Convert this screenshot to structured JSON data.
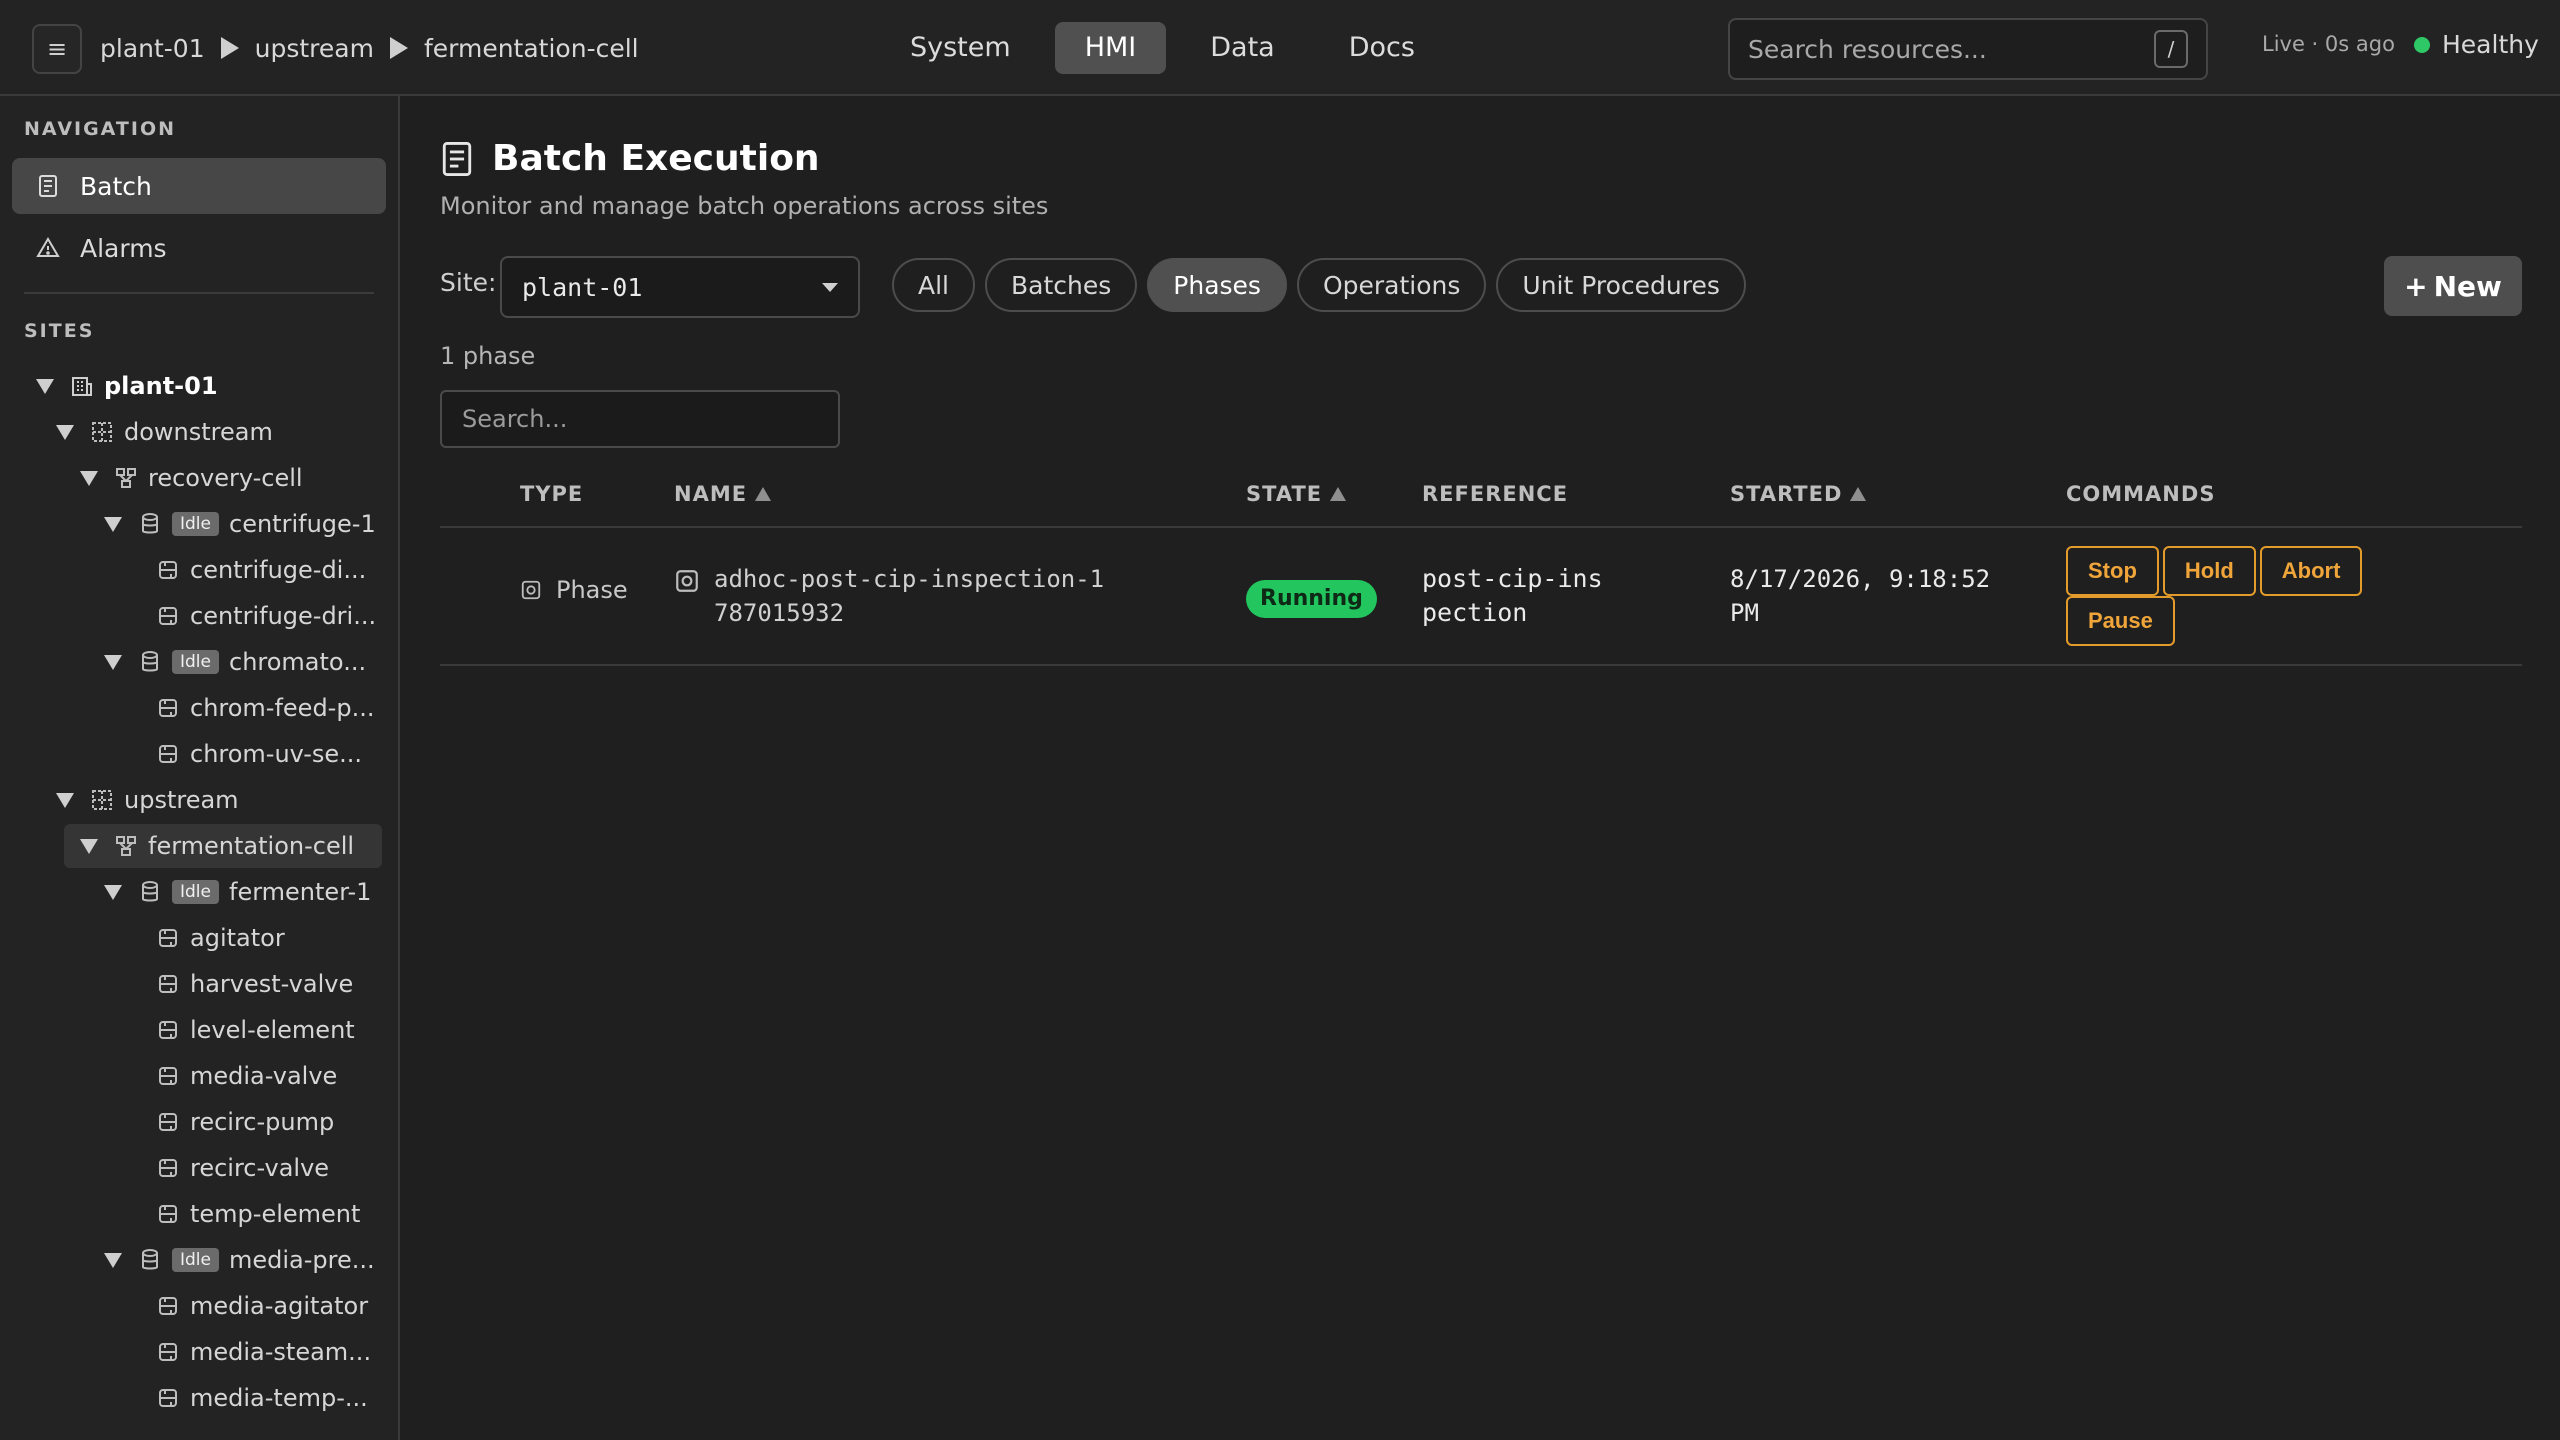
{
  "header": {
    "menu_glyph": "≡",
    "breadcrumb": [
      "plant-01",
      "upstream",
      "fermentation-cell"
    ],
    "tabs": [
      {
        "label": "System",
        "active": false
      },
      {
        "label": "HMI",
        "active": true
      },
      {
        "label": "Data",
        "active": false
      },
      {
        "label": "Docs",
        "active": false
      }
    ],
    "search_placeholder": "Search resources...",
    "search_shortcut": "/",
    "live_status": "Live · 0s ago",
    "health_label": "Healthy",
    "health_color": "#2ec866"
  },
  "sidebar": {
    "navigation_label": "NAVIGATION",
    "nav_items": [
      {
        "label": "Batch",
        "icon": "batch-list-icon",
        "active": true
      },
      {
        "label": "Alarms",
        "icon": "warning-icon",
        "active": false
      }
    ],
    "sites_label": "SITES",
    "idle_label": "Idle",
    "tree": [
      {
        "label": "plant-01",
        "icon": "site-icon",
        "expanded": true,
        "bold": true
      },
      {
        "label": "downstream",
        "icon": "area-icon",
        "expanded": true
      },
      {
        "label": "recovery-cell",
        "icon": "cell-icon",
        "expanded": true
      },
      {
        "label": "centrifuge-1",
        "icon": "unit-icon",
        "expanded": true,
        "badge": "Idle"
      },
      {
        "label": "centrifuge-di...",
        "icon": "equipment-icon"
      },
      {
        "label": "centrifuge-dri...",
        "icon": "equipment-icon"
      },
      {
        "label": "chromato...",
        "icon": "unit-icon",
        "expanded": true,
        "badge": "Idle"
      },
      {
        "label": "chrom-feed-p...",
        "icon": "equipment-icon"
      },
      {
        "label": "chrom-uv-se...",
        "icon": "equipment-icon"
      },
      {
        "label": "upstream",
        "icon": "area-icon",
        "expanded": true
      },
      {
        "label": "fermentation-cell",
        "icon": "cell-icon",
        "expanded": true,
        "selected": true
      },
      {
        "label": "fermenter-1",
        "icon": "unit-icon",
        "expanded": true,
        "badge": "Idle"
      },
      {
        "label": "agitator",
        "icon": "equipment-icon"
      },
      {
        "label": "harvest-valve",
        "icon": "equipment-icon"
      },
      {
        "label": "level-element",
        "icon": "equipment-icon"
      },
      {
        "label": "media-valve",
        "icon": "equipment-icon"
      },
      {
        "label": "recirc-pump",
        "icon": "equipment-icon"
      },
      {
        "label": "recirc-valve",
        "icon": "equipment-icon"
      },
      {
        "label": "temp-element",
        "icon": "equipment-icon"
      },
      {
        "label": "media-pre...",
        "icon": "unit-icon",
        "expanded": true,
        "badge": "Idle"
      },
      {
        "label": "media-agitator",
        "icon": "equipment-icon"
      },
      {
        "label": "media-steam...",
        "icon": "equipment-icon"
      },
      {
        "label": "media-temp-...",
        "icon": "equipment-icon"
      }
    ]
  },
  "main": {
    "title": "Batch Execution",
    "subtitle": "Monitor and manage batch operations across sites",
    "site_label": "Site:",
    "site_value": "plant-01",
    "filters": [
      {
        "label": "All",
        "active": false
      },
      {
        "label": "Batches",
        "active": false
      },
      {
        "label": "Phases",
        "active": true
      },
      {
        "label": "Operations",
        "active": false
      },
      {
        "label": "Unit Procedures",
        "active": false
      }
    ],
    "new_button": "New",
    "count_text": "1 phase",
    "search_placeholder": "Search...",
    "columns": [
      "TYPE",
      "NAME",
      "STATE",
      "REFERENCE",
      "STARTED",
      "COMMANDS"
    ],
    "rows": [
      {
        "type": "Phase",
        "name": "adhoc-post-cip-inspection-1787015932",
        "state": "Running",
        "state_color": "#22c55e",
        "reference": "post-cip-inspection",
        "started": "8/17/2026, 9:18:52 PM",
        "commands": [
          "Stop",
          "Hold",
          "Abort",
          "Pause"
        ]
      }
    ],
    "command_color": "#e39b2b"
  }
}
